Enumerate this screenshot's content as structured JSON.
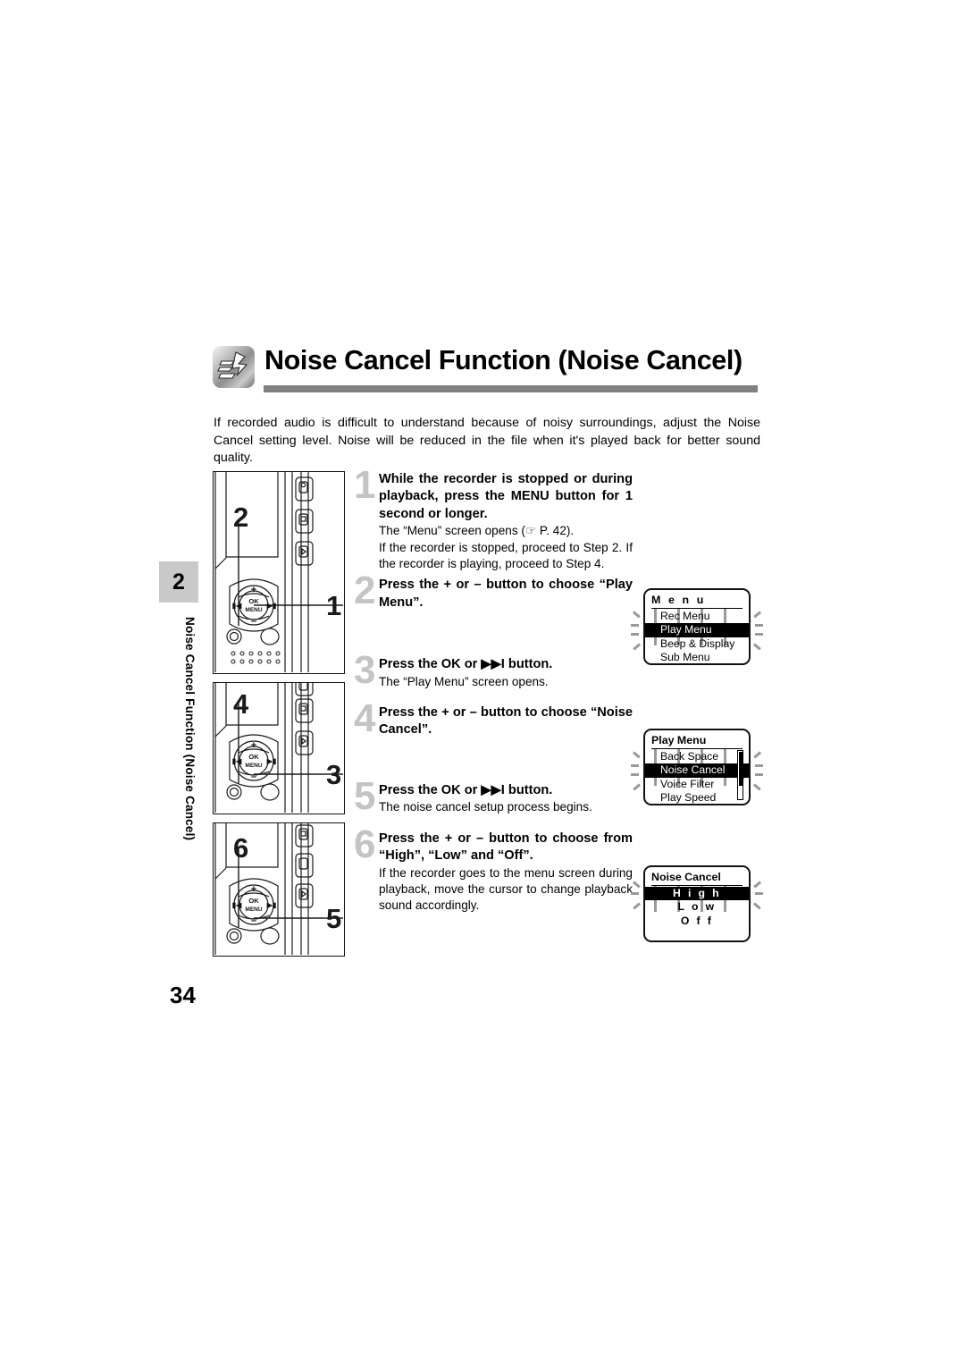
{
  "page": {
    "number": "34",
    "chapter_tab": "2",
    "side_title": "Noise Cancel Function (Noise Cancel)"
  },
  "header": {
    "icon": "noise-cancel-icon",
    "title": "Noise Cancel Function (Noise Cancel)"
  },
  "intro": "If recorded audio is difficult to understand because of noisy surroundings, adjust the Noise Cancel setting level. Noise will be reduced in the file when it's played back for better sound quality.",
  "steps": [
    {
      "num": "1",
      "title": "While the recorder is stopped or during playback, press the MENU button for 1 second or longer.",
      "title_plain_a": "While the recorder is stopped or during playback, press the ",
      "title_bold": "MENU",
      "title_plain_b": " button for 1 second or longer.",
      "body_line1": "The “Menu” screen opens (☞ P. 42).",
      "body_line2": "If the recorder is stopped, proceed to Step 2. If the recorder is playing, proceed to Step 4.",
      "ref_symbol": "☞",
      "ref_page": "P. 42"
    },
    {
      "num": "2",
      "title": "Press the + or – button to choose “Play Menu”.",
      "body": ""
    },
    {
      "num": "3",
      "title": "Press the OK or ▶▶I button.",
      "body": "The “Play Menu” screen opens."
    },
    {
      "num": "4",
      "title": "Press the + or – button to choose “Noise Cancel”.",
      "body": ""
    },
    {
      "num": "5",
      "title": "Press the OK or ▶▶I button.",
      "body": "The noise cancel setup process begins."
    },
    {
      "num": "6",
      "title": "Press the + or – button to choose from “High”, “Low” and “Off”.",
      "body": "If the recorder goes to the menu screen during playback, move the cursor to change playback sound accordingly."
    }
  ],
  "devices": [
    {
      "name": "device-panel-1",
      "callouts": [
        "2",
        "1"
      ],
      "button_label_top": "OK",
      "button_label_bottom": "MENU",
      "plus": "+",
      "minus": "–"
    },
    {
      "name": "device-panel-2",
      "callouts": [
        "4",
        "3"
      ],
      "button_label_top": "OK",
      "button_label_bottom": "MENU",
      "plus": "+",
      "minus": "–"
    },
    {
      "name": "device-panel-3",
      "callouts": [
        "6",
        "5"
      ],
      "button_label_top": "OK",
      "button_label_bottom": "MENU",
      "plus": "+",
      "minus": "–"
    }
  ],
  "lcds": [
    {
      "name": "lcd-menu",
      "title": "M e n u",
      "rows": [
        "Rec Menu",
        "Play Menu",
        "Beep & Display",
        "Sub Menu"
      ],
      "selected_index": 1,
      "scrollbar": false
    },
    {
      "name": "lcd-play-menu",
      "title": "Play Menu",
      "rows": [
        "Back Space",
        "Noise Cancel",
        "Voice Filter",
        "Play Speed"
      ],
      "selected_index": 1,
      "scrollbar": true
    },
    {
      "name": "lcd-noise-cancel",
      "title": "Noise Cancel",
      "rows": [
        "H i g h",
        "L o w",
        "O f f"
      ],
      "selected_index": 0,
      "scrollbar": false
    }
  ],
  "colors": {
    "rule": "#808080",
    "tab": "#c9c9c9",
    "step_number": "#c4c4c4",
    "blink": "#9a9a9a"
  }
}
